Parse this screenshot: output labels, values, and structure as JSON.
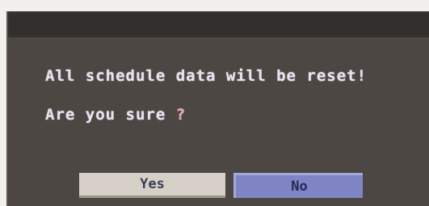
{
  "dialog": {
    "message": "All schedule data will be reset",
    "message_mark": "!",
    "question": "Are you sure",
    "question_mark": "?",
    "yes_label": "Yes",
    "no_label": "No"
  }
}
